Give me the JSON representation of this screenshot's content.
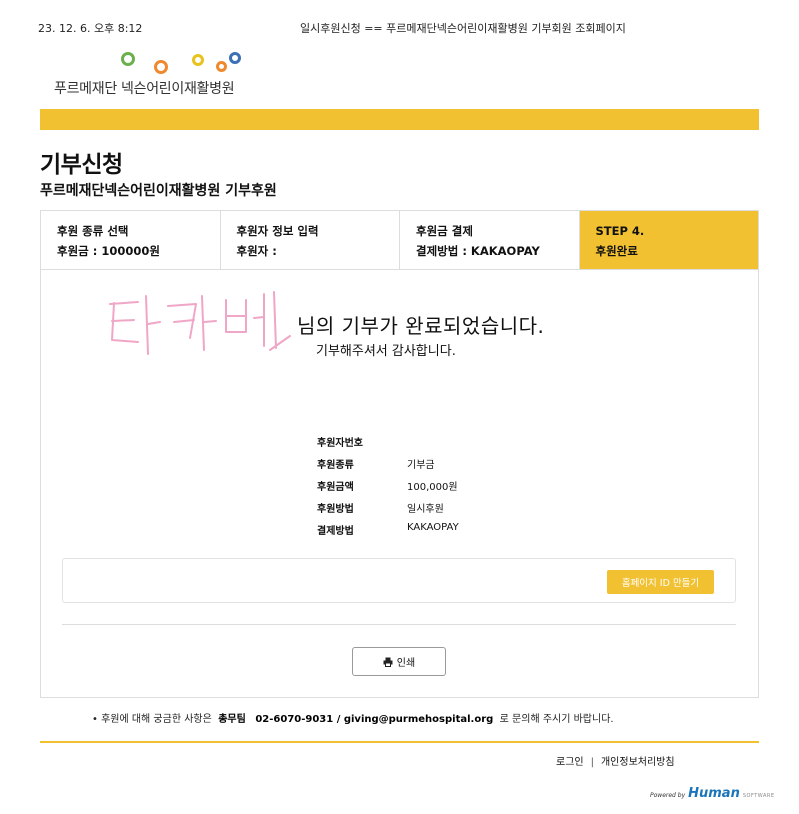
{
  "print_header": {
    "date": "23. 12. 6. 오후 8:12",
    "title": "일시후원신청 == 푸르메재단넥슨어린이재활병원 기부회원 조회페이지"
  },
  "logo": {
    "name": "푸르메재단 넥슨어린이재활병원",
    "dot_colors": [
      "#6ab04c",
      "#f0892e",
      "#e8c21d",
      "#f0892e",
      "#3b6fb6"
    ]
  },
  "accent_color": "#f1c132",
  "page": {
    "title": "기부신청",
    "subtitle": "푸르메재단넥슨어린이재활병원 기부후원"
  },
  "steps": [
    {
      "line1": "후원 종류 선택",
      "line2": "후원금 : 100000원",
      "active": false
    },
    {
      "line1": "후원자 정보 입력",
      "line2": "후원자 :",
      "active": false
    },
    {
      "line1": "후원금 결제",
      "line2": "결제방법 : KAKAOPAY",
      "active": false
    },
    {
      "line1": "STEP 4.",
      "line2": "후원완료",
      "active": true
    }
  ],
  "signature": {
    "text": "타카베",
    "color": "#f0a6c6"
  },
  "message": {
    "main": "님의 기부가 완료되었습니다.",
    "sub": "기부해주셔서 감사합니다."
  },
  "info": [
    {
      "label": "후원자번호",
      "value": ""
    },
    {
      "label": "후원종류",
      "value": "기부금"
    },
    {
      "label": "후원금액",
      "value": "100,000원"
    },
    {
      "label": "후원방법",
      "value": "일시후원"
    },
    {
      "label": "결제방법",
      "value": "KAKAOPAY"
    }
  ],
  "buttons": {
    "homepage_id": "홈페이지 ID 만들기",
    "print": "인쇄"
  },
  "contact": {
    "prefix": "• 후원에 대해 궁금한 사항은",
    "team": "총무팀",
    "details": "02-6070-9031 / giving@purmehospital.org",
    "suffix": "로 문의해 주시기 바랍니다."
  },
  "footer": {
    "login": "로그인",
    "privacy": "개인정보처리방침"
  },
  "powered": {
    "by": "Powered by",
    "brand": "Human",
    "software": "SOFTWARE"
  }
}
